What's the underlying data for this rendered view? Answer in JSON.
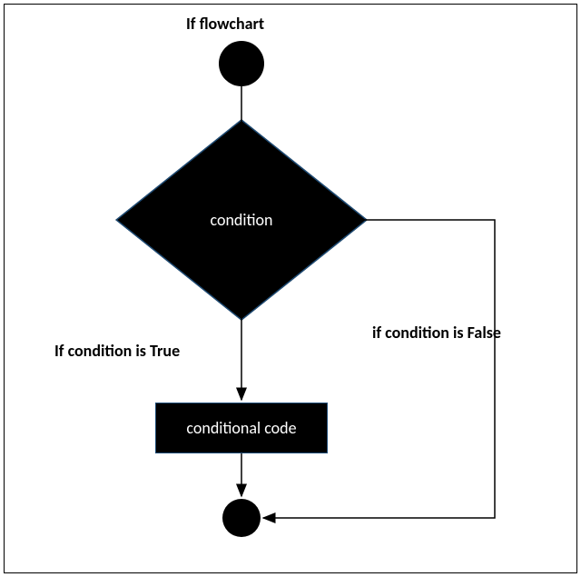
{
  "diagram": {
    "title": "If flowchart",
    "nodes": {
      "start": {
        "type": "start",
        "shape": "circle"
      },
      "condition": {
        "type": "decision",
        "shape": "diamond",
        "label": "condition"
      },
      "code": {
        "type": "process",
        "shape": "rect",
        "label": "conditional code"
      },
      "end": {
        "type": "end",
        "shape": "circle"
      }
    },
    "edges": {
      "true_branch": {
        "from": "condition",
        "to": "code",
        "label": "If condition is True"
      },
      "false_branch": {
        "from": "condition",
        "to": "end",
        "label": "if condition is False"
      }
    }
  }
}
